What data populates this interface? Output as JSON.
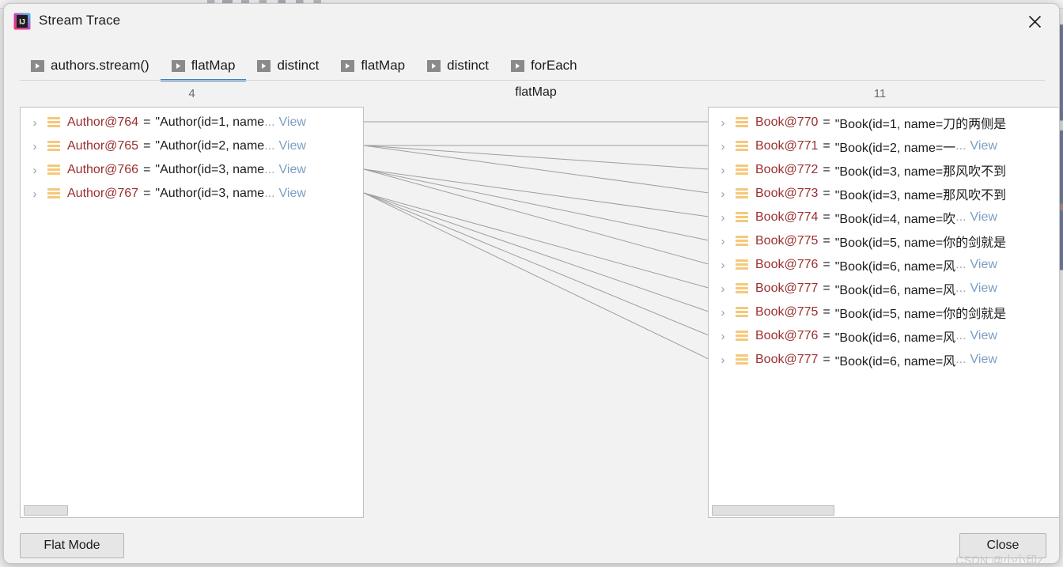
{
  "window": {
    "title": "Stream Trace",
    "app_icon": "intellij-idea-icon",
    "close_icon": "close-icon"
  },
  "tabs": [
    {
      "label": "authors.stream()",
      "icon": "play-icon",
      "active": false
    },
    {
      "label": "flatMap",
      "icon": "play-icon",
      "active": true
    },
    {
      "label": "distinct",
      "icon": "play-icon",
      "active": false
    },
    {
      "label": "flatMap",
      "icon": "play-icon",
      "active": false
    },
    {
      "label": "distinct",
      "icon": "play-icon",
      "active": false
    },
    {
      "label": "forEach",
      "icon": "play-icon",
      "active": false
    }
  ],
  "operation": {
    "label": "flatMap"
  },
  "left_panel": {
    "count": "4",
    "rows": [
      {
        "ref": "Author@764",
        "eq": "=",
        "value": "\"Author(id=1, name",
        "ellipsis": "...",
        "view": "View"
      },
      {
        "ref": "Author@765",
        "eq": "=",
        "value": "\"Author(id=2, name",
        "ellipsis": "...",
        "view": "View"
      },
      {
        "ref": "Author@766",
        "eq": "=",
        "value": "\"Author(id=3, name",
        "ellipsis": "...",
        "view": "View"
      },
      {
        "ref": "Author@767",
        "eq": "=",
        "value": "\"Author(id=3, name",
        "ellipsis": "...",
        "view": "View"
      }
    ],
    "scrollbar": "horizontal-scrollbar"
  },
  "right_panel": {
    "count": "11",
    "rows": [
      {
        "ref": "Book@770",
        "eq": "=",
        "value": "\"Book(id=1, name=刀的两侧是",
        "ellipsis": "",
        "view": ""
      },
      {
        "ref": "Book@771",
        "eq": "=",
        "value": "\"Book(id=2, name=一",
        "ellipsis": "...",
        "view": "View"
      },
      {
        "ref": "Book@772",
        "eq": "=",
        "value": "\"Book(id=3, name=那风吹不到",
        "ellipsis": "",
        "view": ""
      },
      {
        "ref": "Book@773",
        "eq": "=",
        "value": "\"Book(id=3, name=那风吹不到",
        "ellipsis": "",
        "view": ""
      },
      {
        "ref": "Book@774",
        "eq": "=",
        "value": "\"Book(id=4, name=吹",
        "ellipsis": "...",
        "view": "View"
      },
      {
        "ref": "Book@775",
        "eq": "=",
        "value": "\"Book(id=5, name=你的剑就是",
        "ellipsis": "",
        "view": ""
      },
      {
        "ref": "Book@776",
        "eq": "=",
        "value": "\"Book(id=6, name=风",
        "ellipsis": "...",
        "view": "View"
      },
      {
        "ref": "Book@777",
        "eq": "=",
        "value": "\"Book(id=6, name=风",
        "ellipsis": "...",
        "view": "View"
      },
      {
        "ref": "Book@775",
        "eq": "=",
        "value": "\"Book(id=5, name=你的剑就是",
        "ellipsis": "",
        "view": ""
      },
      {
        "ref": "Book@776",
        "eq": "=",
        "value": "\"Book(id=6, name=风",
        "ellipsis": "...",
        "view": "View"
      },
      {
        "ref": "Book@777",
        "eq": "=",
        "value": "\"Book(id=6, name=风",
        "ellipsis": "...",
        "view": "View"
      }
    ],
    "scrollbar": "horizontal-scrollbar"
  },
  "links": [
    {
      "from": 0,
      "to": 0
    },
    {
      "from": 1,
      "to": 1
    },
    {
      "from": 1,
      "to": 2
    },
    {
      "from": 1,
      "to": 3
    },
    {
      "from": 2,
      "to": 4
    },
    {
      "from": 2,
      "to": 5
    },
    {
      "from": 2,
      "to": 6
    },
    {
      "from": 3,
      "to": 7
    },
    {
      "from": 3,
      "to": 8
    },
    {
      "from": 3,
      "to": 9
    },
    {
      "from": 3,
      "to": 10
    }
  ],
  "footer": {
    "flat_mode_label": "Flat Mode",
    "close_label": "Close"
  },
  "watermark": {
    "text": "CSDN @小小印z"
  },
  "colors": {
    "accent": "#3e7fc1",
    "reference": "#9b2f2f",
    "link": "#7b9ec4",
    "count_text": "#6d6d6d",
    "panel_bg": "#ffffff",
    "dialog_bg": "#f2f2f2",
    "connector": "#9e9e9e"
  }
}
